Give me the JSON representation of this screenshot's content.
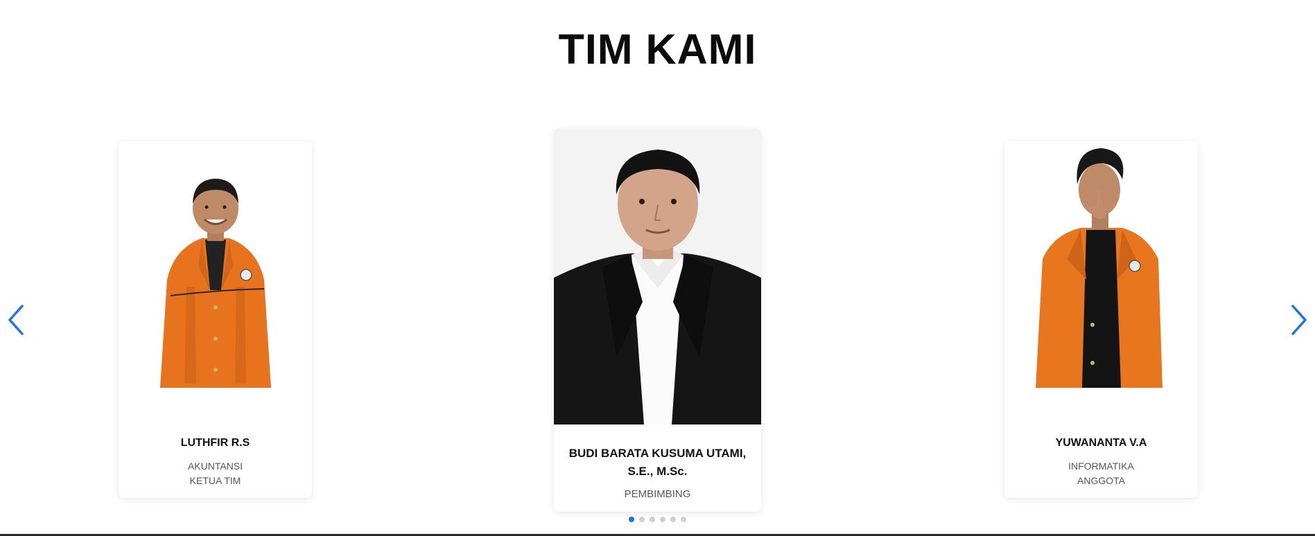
{
  "section": {
    "title": "TIM KAMI"
  },
  "carousel": {
    "prev_icon": "chevron-left-icon",
    "next_icon": "chevron-right-icon",
    "accent_color": "#1a73e8",
    "dot_count": 6,
    "active_dot": 1
  },
  "members": {
    "left": {
      "name": "LUTHFIR R.S",
      "department": "AKUNTANSI",
      "role": "KETUA TIM",
      "photo": "student-orange-jacket-photo"
    },
    "center": {
      "name": "BUDI BARATA KUSUMA UTAMI, S.E., M.Sc.",
      "role": "PEMBIMBING",
      "photo": "supervisor-black-suit-photo"
    },
    "right": {
      "name": "YUWANANTA V.A",
      "department": "INFORMATIKA",
      "role": "ANGGOTA",
      "photo": "student-orange-jacket-photo"
    }
  }
}
